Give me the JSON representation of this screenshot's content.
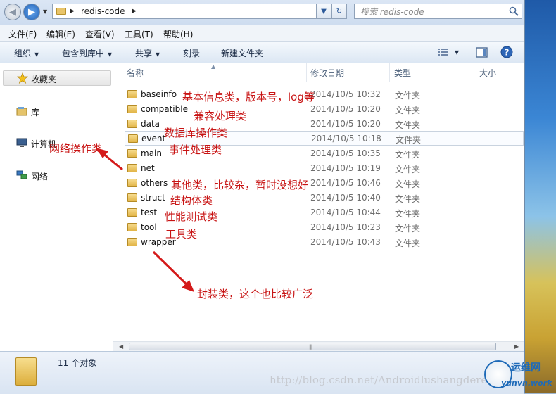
{
  "address": {
    "crumb": "redis-code",
    "search_placeholder": "搜索 redis-code"
  },
  "menu": [
    "文件(F)",
    "编辑(E)",
    "查看(V)",
    "工具(T)",
    "帮助(H)"
  ],
  "toolbar": {
    "organize": "组织",
    "include_in_library": "包含到库中",
    "share": "共享",
    "burn": "刻录",
    "new_folder": "新建文件夹"
  },
  "nav": {
    "favorites": "收藏夹",
    "library": "库",
    "computer": "计算机",
    "network": "网络"
  },
  "columns": {
    "name": "名称",
    "date": "修改日期",
    "type": "类型",
    "size": "大小"
  },
  "files": [
    {
      "name": "baseinfo",
      "date": "2014/10/5 10:32",
      "type": "文件夹"
    },
    {
      "name": "compatible",
      "date": "2014/10/5 10:20",
      "type": "文件夹"
    },
    {
      "name": "data",
      "date": "2014/10/5 10:20",
      "type": "文件夹"
    },
    {
      "name": "event",
      "date": "2014/10/5 10:18",
      "type": "文件夹"
    },
    {
      "name": "main",
      "date": "2014/10/5 10:35",
      "type": "文件夹"
    },
    {
      "name": "net",
      "date": "2014/10/5 10:19",
      "type": "文件夹"
    },
    {
      "name": "others",
      "date": "2014/10/5 10:46",
      "type": "文件夹"
    },
    {
      "name": "struct",
      "date": "2014/10/5 10:40",
      "type": "文件夹"
    },
    {
      "name": "test",
      "date": "2014/10/5 10:44",
      "type": "文件夹"
    },
    {
      "name": "tool",
      "date": "2014/10/5 10:23",
      "type": "文件夹"
    },
    {
      "name": "wrapper",
      "date": "2014/10/5 10:43",
      "type": "文件夹"
    }
  ],
  "annotations": {
    "baseinfo": "基本信息类，版本号，log等",
    "compatible": "兼容处理类",
    "data": "数据库操作类",
    "main": "事件处理类",
    "net": "网络操作类",
    "others": "其他类，比较杂，暂时没想好",
    "struct": "结构体类",
    "test": "性能测试类",
    "tool": "工具类",
    "wrapper": "封装类，这个也比较广泛"
  },
  "status": {
    "count": "11 个对象"
  },
  "watermark": {
    "url": "http://blog.csdn.net/Androidlushangderen",
    "logo_cn": "运维网",
    "logo_en": "yunvn.work"
  },
  "colors": {
    "annotation": "#c81414",
    "selection_border": "#c9d3df",
    "folder": "#e8c46a"
  },
  "icons": [
    "back-arrow-icon",
    "forward-arrow-icon",
    "folder-icon",
    "refresh-icon",
    "search-icon",
    "star-icon",
    "library-icon",
    "computer-icon",
    "network-icon",
    "view-options-icon",
    "preview-pane-icon",
    "help-icon",
    "red-arrow"
  ]
}
